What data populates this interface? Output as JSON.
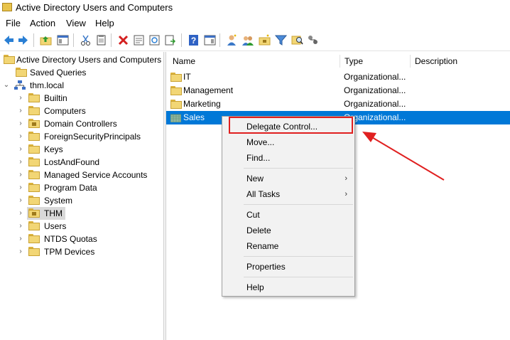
{
  "window": {
    "title": "Active Directory Users and Computers"
  },
  "menubar": {
    "items": [
      "File",
      "Action",
      "View",
      "Help"
    ]
  },
  "toolbar": {
    "icons": [
      "back-arrow-icon",
      "forward-arrow-icon",
      "up-folder-icon",
      "show-hide-console-tree-icon",
      "cut-icon",
      "copy-icon",
      "delete-icon",
      "properties-icon",
      "refresh-icon",
      "export-list-icon",
      "help-icon",
      "action-pane-icon",
      "new-user-icon",
      "new-group-icon",
      "new-ou-icon",
      "filter-icon",
      "find-icon",
      "delegate-icon"
    ]
  },
  "tree": {
    "root": "Active Directory Users and Computers",
    "saved_queries": "Saved Queries",
    "domain": "thm.local",
    "children": [
      "Builtin",
      "Computers",
      "Domain Controllers",
      "ForeignSecurityPrincipals",
      "Keys",
      "LostAndFound",
      "Managed Service Accounts",
      "Program Data",
      "System",
      "THM",
      "Users",
      "NTDS Quotas",
      "TPM Devices"
    ],
    "selected": "THM"
  },
  "list": {
    "columns": {
      "name": "Name",
      "type": "Type",
      "description": "Description"
    },
    "rows": [
      {
        "name": "IT",
        "type": "Organizational..."
      },
      {
        "name": "Management",
        "type": "Organizational..."
      },
      {
        "name": "Marketing",
        "type": "Organizational..."
      },
      {
        "name": "Sales",
        "type": "Organizational..."
      }
    ],
    "selected": "Sales"
  },
  "context_menu": {
    "delegate": "Delegate Control...",
    "move": "Move...",
    "find": "Find...",
    "new": "New",
    "all_tasks": "All Tasks",
    "cut": "Cut",
    "delete": "Delete",
    "rename": "Rename",
    "properties": "Properties",
    "help": "Help",
    "submenu_arrow": "›"
  },
  "colors": {
    "selection": "#0078d7",
    "annotation": "#e02020"
  }
}
